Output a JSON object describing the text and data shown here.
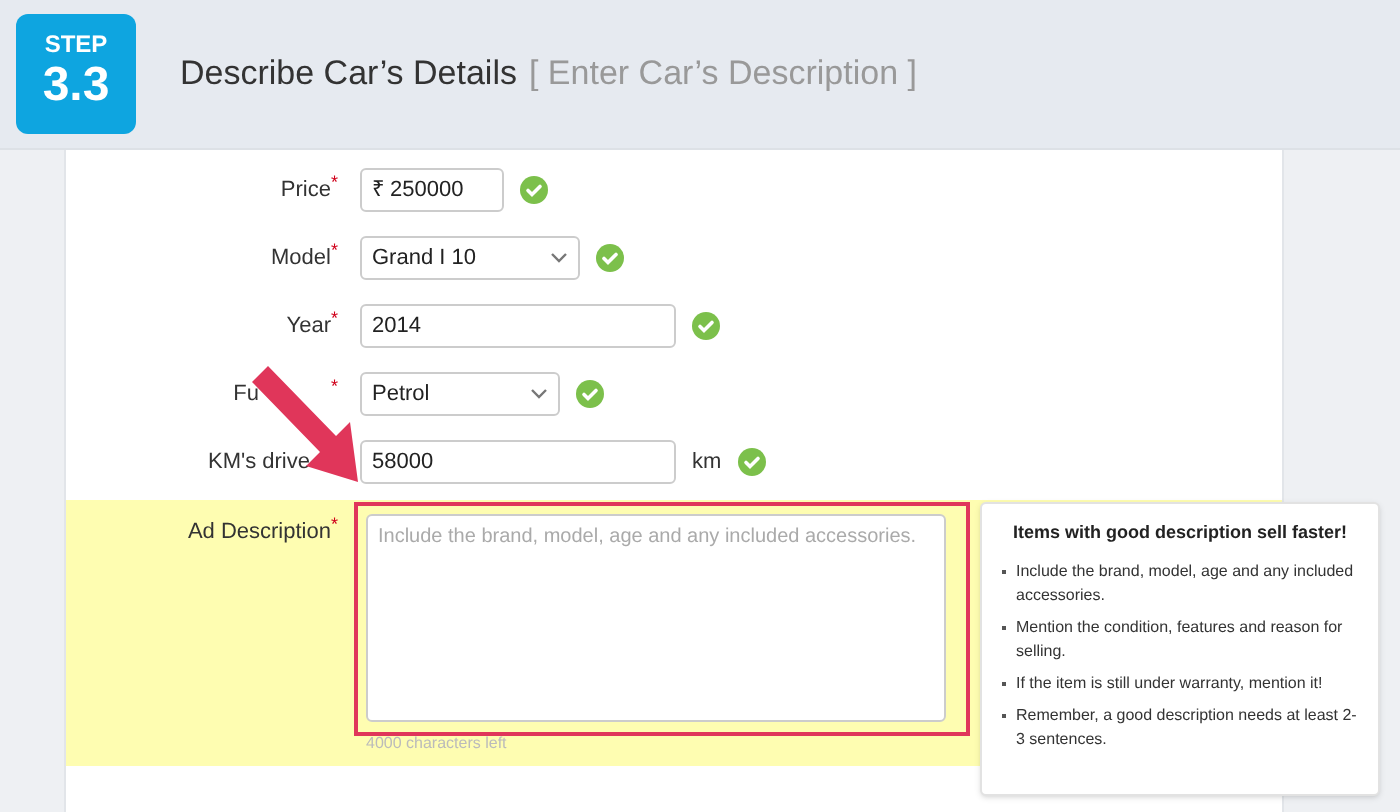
{
  "header": {
    "step_label": "STEP",
    "step_number": "3.3",
    "title": "Describe Car’s Details",
    "subtitle": "[ Enter Car’s Description ]"
  },
  "fields": [
    {
      "kind": "text",
      "label": "Price",
      "required_mark": "*",
      "value": "₹ 250000",
      "valid": true
    },
    {
      "kind": "select",
      "label": "Model",
      "required_mark": "*",
      "value": "Grand I 10",
      "valid": true
    },
    {
      "kind": "text",
      "label": "Year",
      "required_mark": "*",
      "value": "2014",
      "valid": true
    },
    {
      "kind": "select",
      "label": "Fu",
      "required_mark": "*",
      "value": "Petrol",
      "valid": true
    },
    {
      "kind": "text",
      "label": "KM's drive",
      "value": "58000",
      "unit": "km",
      "valid": true
    }
  ],
  "description": {
    "label": "Ad Description",
    "required_mark": "*",
    "placeholder": "Include the brand, model, age and any included accessories.",
    "counter": "4000 characters left",
    "highlighted": true
  },
  "tip": {
    "title": "Items with good description sell faster!",
    "items": [
      "Include the brand, model, age and any included accessories.",
      "Mention the condition, features and reason for selling.",
      "If the item is still under warranty, mention it!",
      "Remember, a good description needs at least 2-3 sentences."
    ]
  }
}
